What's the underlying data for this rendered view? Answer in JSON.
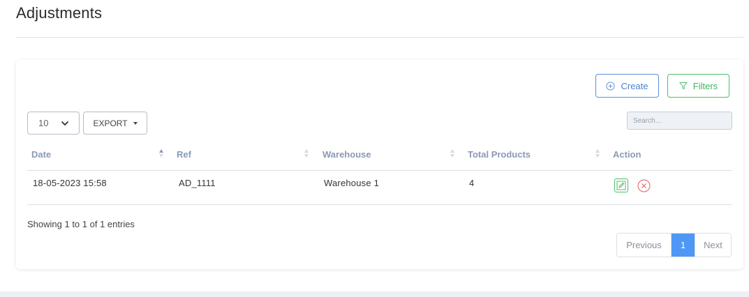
{
  "page": {
    "title": "Adjustments"
  },
  "toolbar": {
    "create_label": "Create",
    "create_icon": "plus-circle-icon",
    "filters_label": "Filters",
    "filters_icon": "filter-icon",
    "per_page_value": "10",
    "export_label": "EXPORT",
    "search_placeholder": "Search..."
  },
  "table": {
    "columns": [
      {
        "label": "Date",
        "sorted": "asc"
      },
      {
        "label": "Ref"
      },
      {
        "label": "Warehouse"
      },
      {
        "label": "Total Products"
      },
      {
        "label": "Action"
      }
    ],
    "rows": [
      {
        "date": "18-05-2023 15:58",
        "ref": "AD_1111",
        "warehouse": "Warehouse 1",
        "total_products": "4"
      }
    ]
  },
  "footer": {
    "info": "Showing 1 to 1 of 1 entries",
    "pagination": {
      "previous": "Previous",
      "current": "1",
      "next": "Next"
    }
  },
  "colors": {
    "primary": "#4e97f5",
    "create_border": "#5b8fd6",
    "success": "#4cbe6a",
    "danger": "#e05a5a",
    "header_text": "#8a9ab5"
  }
}
